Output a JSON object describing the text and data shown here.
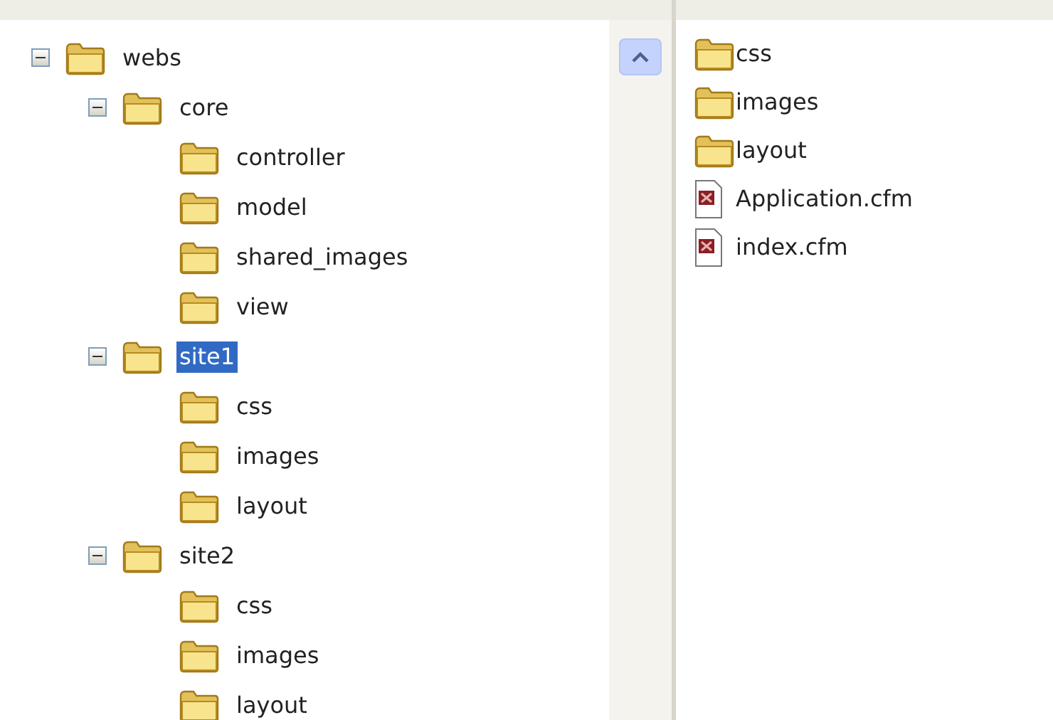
{
  "tree": [
    {
      "label": "webs",
      "expanded": true,
      "selected": false,
      "children": [
        {
          "label": "core",
          "expanded": true,
          "selected": false,
          "children": [
            {
              "label": "controller",
              "selected": false
            },
            {
              "label": "model",
              "selected": false
            },
            {
              "label": "shared_images",
              "selected": false
            },
            {
              "label": "view",
              "selected": false
            }
          ]
        },
        {
          "label": "site1",
          "expanded": true,
          "selected": true,
          "children": [
            {
              "label": "css",
              "selected": false
            },
            {
              "label": "images",
              "selected": false
            },
            {
              "label": "layout",
              "selected": false
            }
          ]
        },
        {
          "label": "site2",
          "expanded": true,
          "selected": false,
          "children": [
            {
              "label": "css",
              "selected": false
            },
            {
              "label": "images",
              "selected": false
            },
            {
              "label": "layout",
              "selected": false
            }
          ]
        }
      ]
    }
  ],
  "files": [
    {
      "label": "css",
      "kind": "folder"
    },
    {
      "label": "images",
      "kind": "folder"
    },
    {
      "label": "layout",
      "kind": "folder"
    },
    {
      "label": "Application.cfm",
      "kind": "file"
    },
    {
      "label": "index.cfm",
      "kind": "file"
    }
  ]
}
